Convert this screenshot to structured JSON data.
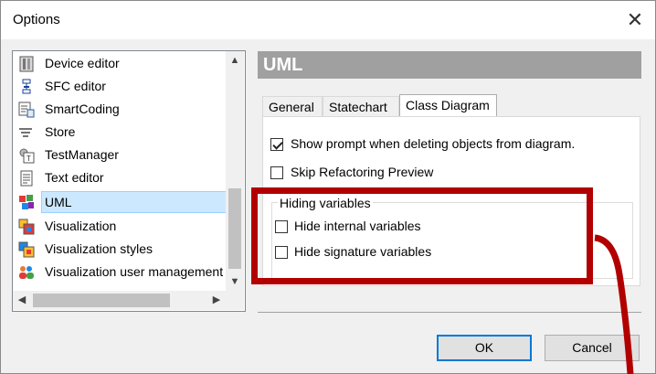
{
  "window": {
    "title": "Options"
  },
  "tree": {
    "items": [
      {
        "label": "Device editor",
        "icon": "device-editor-icon"
      },
      {
        "label": "SFC editor",
        "icon": "sfc-editor-icon"
      },
      {
        "label": "SmartCoding",
        "icon": "smartcoding-icon"
      },
      {
        "label": "Store",
        "icon": "store-icon"
      },
      {
        "label": "TestManager",
        "icon": "testmanager-icon"
      },
      {
        "label": "Text editor",
        "icon": "text-editor-icon"
      },
      {
        "label": "UML",
        "icon": "uml-icon",
        "selected": true
      },
      {
        "label": "Visualization",
        "icon": "visualization-icon"
      },
      {
        "label": "Visualization styles",
        "icon": "visualization-styles-icon"
      },
      {
        "label": "Visualization user management",
        "icon": "users-icon"
      }
    ]
  },
  "section": {
    "title": "UML"
  },
  "tabs": [
    {
      "label": "General"
    },
    {
      "label": "Statechart"
    },
    {
      "label": "Class Diagram",
      "active": true
    }
  ],
  "options": {
    "show_prompt": {
      "label": "Show prompt when deleting objects from diagram.",
      "checked": true
    },
    "skip_refactoring": {
      "label": "Skip Refactoring Preview",
      "checked": false
    }
  },
  "hiding": {
    "title": "Hiding variables",
    "internal": {
      "label": "Hide internal variables",
      "checked": false
    },
    "signature": {
      "label": "Hide signature variables",
      "checked": false
    }
  },
  "buttons": {
    "ok": "OK",
    "cancel": "Cancel"
  },
  "colors": {
    "highlight": "#b20000",
    "selection": "#cce8ff",
    "header_bg": "#a0a0a0"
  }
}
